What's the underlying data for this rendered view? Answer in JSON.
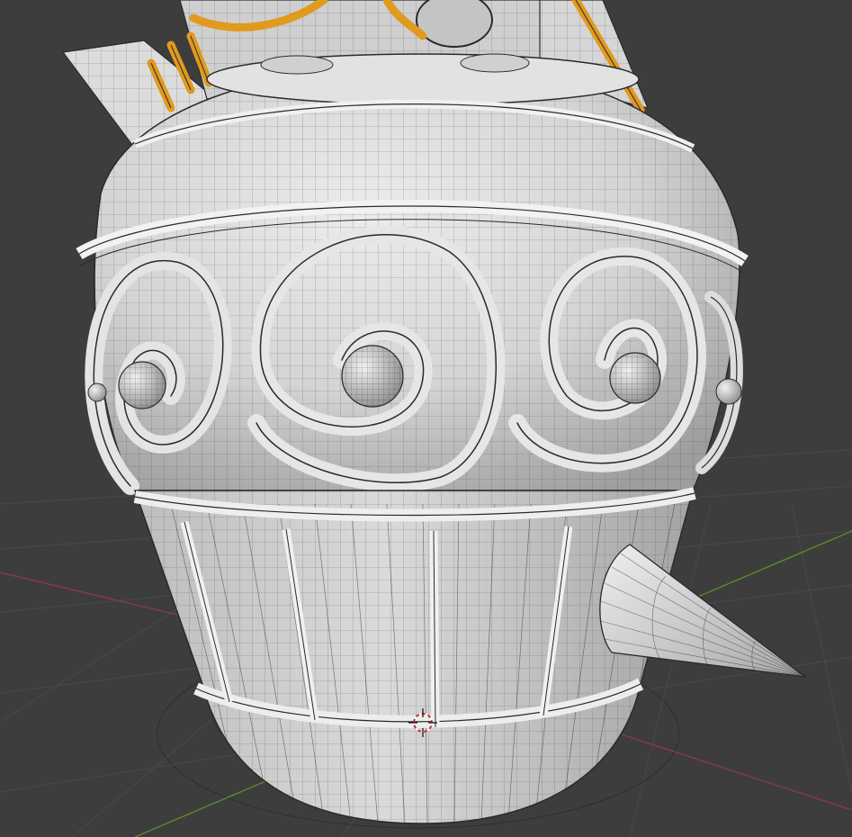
{
  "viewport": {
    "background": "#3d3d3d",
    "grid_color": "#4a4a4a",
    "x_axis_color": "#8c3a44",
    "y_axis_color": "#5a8a2c"
  },
  "model": {
    "surface_color": "#d9d9d9",
    "shadow_color": "#9a9a9a",
    "wire_color": "#2a2a2a",
    "accent_color": "#e09a1f",
    "shading": "wireframe-overlay"
  },
  "icons": {
    "origin": "3d-cursor-icon"
  }
}
